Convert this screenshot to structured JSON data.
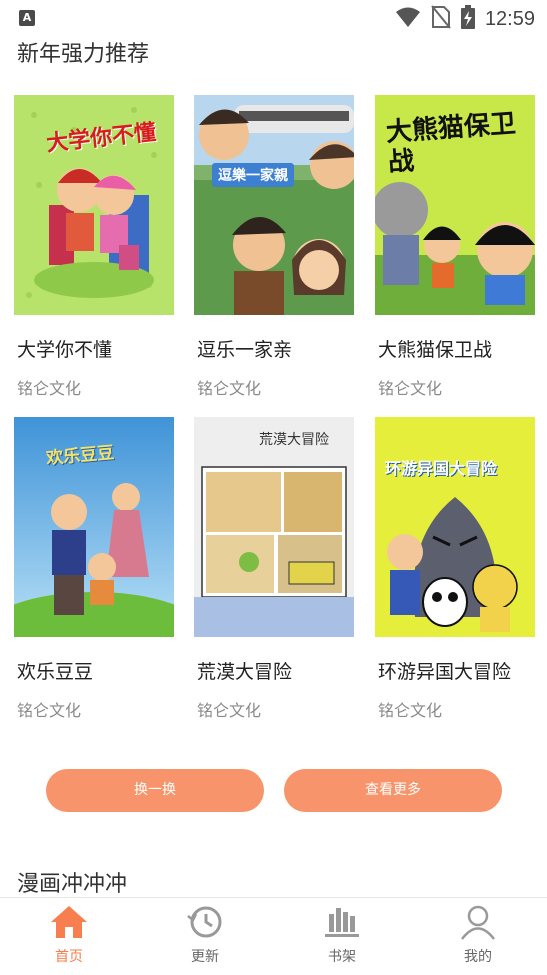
{
  "status": {
    "time": "12:59",
    "left_icon": "A",
    "icons": [
      "wifi-icon",
      "no-sim-icon",
      "battery-charging-icon"
    ]
  },
  "sections": {
    "recommend_title": "新年强力推荐",
    "second_title": "漫画冲冲冲"
  },
  "books": [
    {
      "title": "大学你不懂",
      "author": "铭仑文化",
      "cover_text": "大学你不懂",
      "cover_bg": "#b7e36a"
    },
    {
      "title": "逗乐一家亲",
      "author": "铭仑文化",
      "cover_text": "逗樂一家親",
      "cover_bg": "#6fa85a"
    },
    {
      "title": "大熊猫保卫战",
      "author": "铭仑文化",
      "cover_text": "大熊猫保卫战",
      "cover_bg": "#c8e84a"
    },
    {
      "title": "欢乐豆豆",
      "author": "铭仑文化",
      "cover_text": "欢乐豆豆",
      "cover_bg": "#6bb5e8"
    },
    {
      "title": "荒漠大冒险",
      "author": "铭仑文化",
      "cover_text": "荒漠大冒险",
      "cover_bg": "#eeeeee"
    },
    {
      "title": "环游异国大冒险",
      "author": "铭仑文化",
      "cover_text": "环游异国大冒险",
      "cover_bg": "#e6ee3c"
    }
  ],
  "buttons": {
    "refresh": "换一换",
    "more": "查看更多"
  },
  "nav": [
    {
      "label": "首页",
      "icon": "home-icon",
      "active": true
    },
    {
      "label": "更新",
      "icon": "history-icon",
      "active": false
    },
    {
      "label": "书架",
      "icon": "bookshelf-icon",
      "active": false
    },
    {
      "label": "我的",
      "icon": "profile-icon",
      "active": false
    }
  ],
  "colors": {
    "accent": "#f77e4e",
    "button": "#f7946b"
  }
}
